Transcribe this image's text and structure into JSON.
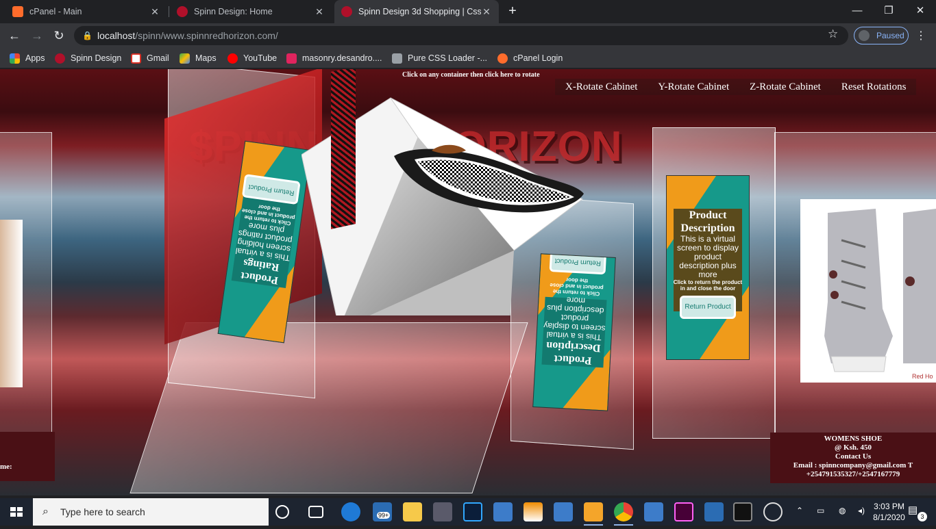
{
  "tabs": [
    {
      "title": "cPanel - Main",
      "icon": "cpanel-icon",
      "color": "#ff6c2c"
    },
    {
      "title": "Spinn Design: Home",
      "icon": "spinn-icon",
      "color": "#b0102a"
    },
    {
      "title": "Spinn Design 3d Shopping | Css",
      "icon": "spinn-icon",
      "color": "#b0102a"
    }
  ],
  "toolbar": {
    "url_host": "localhost",
    "url_path": "/spinn/www.spinnredhorizon.com/",
    "profile_status": "Paused"
  },
  "bookmarks": [
    {
      "label": "Apps",
      "icon": "apps-grid-icon",
      "color": "#ea4335"
    },
    {
      "label": "Spinn Design",
      "icon": "spinn-icon",
      "color": "#b0102a"
    },
    {
      "label": "Gmail",
      "icon": "gmail-icon",
      "color": "#d93025"
    },
    {
      "label": "Maps",
      "icon": "maps-icon",
      "color": "#34a853"
    },
    {
      "label": "YouTube",
      "icon": "youtube-icon",
      "color": "#ff0000"
    },
    {
      "label": "masonry.desandro....",
      "icon": "masonry-icon",
      "color": "#e0245e"
    },
    {
      "label": "Pure CSS Loader -...",
      "icon": "loader-icon",
      "color": "#9aa0a6"
    },
    {
      "label": "cPanel Login",
      "icon": "cpanel-icon",
      "color": "#ff6c2c"
    }
  ],
  "page": {
    "hint": "Click on any container then click here to rotate",
    "rotate_buttons": [
      "X-Rotate Cabinet",
      "Y-Rotate Cabinet",
      "Z-Rotate Cabinet",
      "Reset Rotations"
    ],
    "logo_text": "$PINN REDHORIZON",
    "card_right": {
      "title": "Product Description",
      "body": "This is a virtual screen to display product description plus more",
      "note": "Click to return the product in and close the door",
      "button": "Return Product"
    },
    "card_center": {
      "title": "Product Description",
      "body": "This is a virtual screen to display product description plus more",
      "note": "Click to return the product in and close the door",
      "button": "Return Product"
    },
    "card_left": {
      "title": "Product Ratings",
      "body": "This is a virtual screen holding product ratings plus more",
      "note": "Click to return the product in and close the door",
      "button": "Return Product"
    },
    "left_tag": "me:",
    "right_tag": {
      "name": "WOMENS SHOE",
      "price": "@ Ksh. 450",
      "contact": "Contact Us",
      "email": "Email : spinncompany@gmail.com T",
      "phone": "+254791535327/+2547167779"
    },
    "brand_small": "Red Ho"
  },
  "taskbar": {
    "search_placeholder": "Type here to search",
    "mail_badge": "99+",
    "time": "3:03 PM",
    "date": "8/1/2020",
    "notifications": "3"
  },
  "colors": {
    "accent": "#8ab4f8",
    "card_teal": "#16998a",
    "card_orange": "#f09b1a",
    "stage_red": "#7d1d22"
  }
}
